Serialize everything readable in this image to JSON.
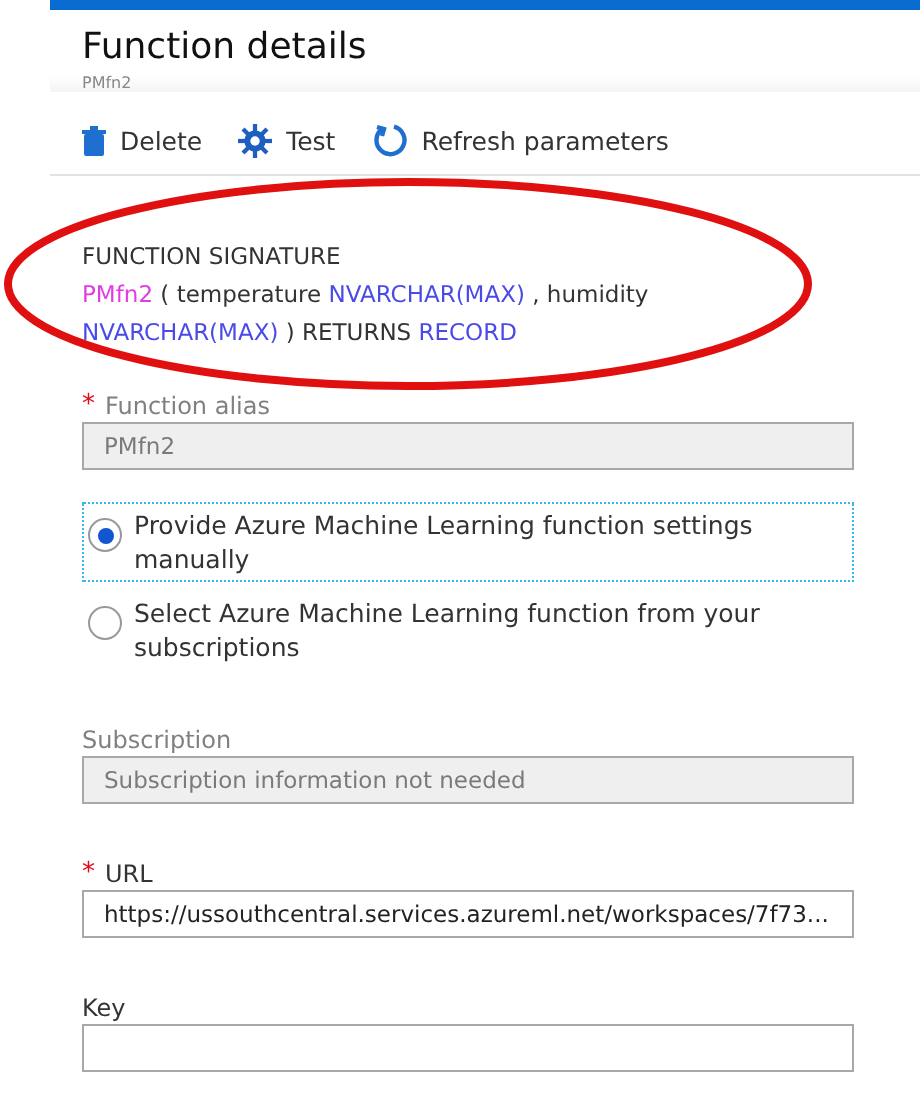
{
  "header": {
    "title": "Function details",
    "subtitle": "PMfn2"
  },
  "toolbar": [
    {
      "kind": "delete",
      "label": "Delete"
    },
    {
      "kind": "test",
      "label": "Test"
    },
    {
      "kind": "refresh",
      "label": "Refresh parameters"
    }
  ],
  "signature": {
    "label": "FUNCTION SIGNATURE",
    "segments": [
      {
        "kind": "name",
        "text": "PMfn2"
      },
      {
        "kind": "plain",
        "text": "( temperature"
      },
      {
        "kind": "type",
        "text": "NVARCHAR(MAX)"
      },
      {
        "kind": "plain",
        "text": ", humidity"
      },
      {
        "kind": "type",
        "text": "NVARCHAR(MAX)"
      },
      {
        "kind": "plain",
        "text": ") RETURNS"
      },
      {
        "kind": "type",
        "text": "RECORD"
      }
    ]
  },
  "annotation": {
    "kind": "ellipse",
    "color": "#e01010"
  },
  "alias_field": {
    "label": "Function alias",
    "required_mark": "*",
    "disabled": true,
    "value": "PMfn2"
  },
  "source_options": [
    {
      "label": "Provide Azure Machine Learning function settings manually",
      "selected": true,
      "focused": true
    },
    {
      "label": "Select Azure Machine Learning function from your subscriptions",
      "selected": false,
      "focused": false
    }
  ],
  "fields": [
    {
      "label": "Subscription",
      "disabled": true,
      "value": "Subscription information not needed"
    },
    {
      "label": "URL",
      "required_mark": "*",
      "disabled": false,
      "value": "https://ussouthcentral.services.azureml.net/workspaces/7f73..."
    },
    {
      "label": "Key",
      "disabled": false
    }
  ]
}
